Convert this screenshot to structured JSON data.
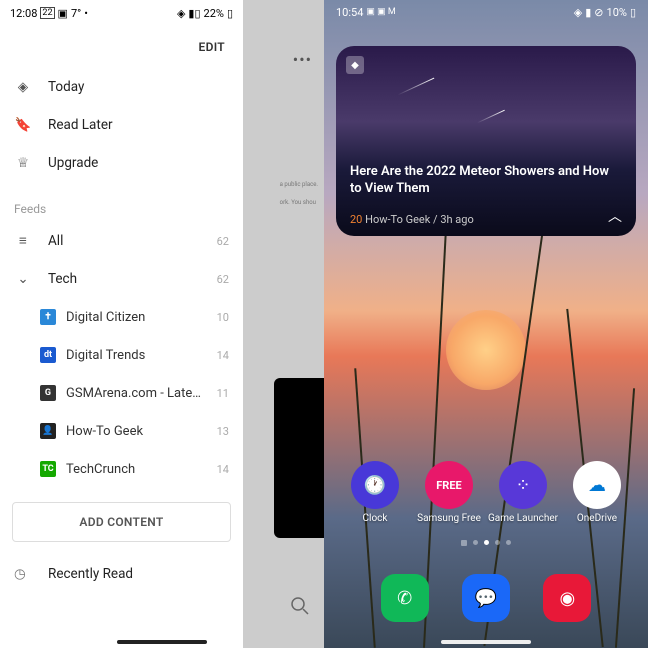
{
  "left": {
    "status": {
      "time": "12:08",
      "badge": "22",
      "temp": "7°",
      "battery": "22%"
    },
    "edit": "EDIT",
    "nav": [
      {
        "label": "Today",
        "icon": "today"
      },
      {
        "label": "Read Later",
        "icon": "bookmark"
      },
      {
        "label": "Upgrade",
        "icon": "crown"
      }
    ],
    "feeds_header": "Feeds",
    "feeds": {
      "all": {
        "label": "All",
        "count": "62"
      },
      "tech": {
        "label": "Tech",
        "count": "62"
      },
      "subs": [
        {
          "label": "Digital Citizen",
          "count": "10",
          "color": "#2a88d8"
        },
        {
          "label": "Digital Trends",
          "count": "14",
          "color": "#1a5ad0"
        },
        {
          "label": "GSMArena.com - Latest ...",
          "count": "11",
          "color": "#333"
        },
        {
          "label": "How-To Geek",
          "count": "13",
          "color": "#222"
        },
        {
          "label": "TechCrunch",
          "count": "14",
          "color": "#14a800"
        }
      ]
    },
    "add_content": "ADD CONTENT",
    "recently_read": "Recently Read"
  },
  "right": {
    "status": {
      "time": "10:54",
      "battery": "10%"
    },
    "widget": {
      "title": "Here Are the 2022 Meteor Showers and How to View Them",
      "count": "20",
      "source": "How-To Geek",
      "age": "3h ago"
    },
    "apps_row1": [
      {
        "label": "Clock",
        "color": "#4838d8"
      },
      {
        "label": "Samsung Free",
        "color": "#e8186a",
        "text": "FREE"
      },
      {
        "label": "Game Launcher",
        "color": "#5838d8"
      },
      {
        "label": "OneDrive",
        "color": "#ffffff"
      }
    ],
    "apps_dock": [
      {
        "label": "",
        "color": "#10b858"
      },
      {
        "label": "",
        "color": "#1a68f8"
      },
      {
        "label": "",
        "color": "#e81838"
      }
    ]
  }
}
